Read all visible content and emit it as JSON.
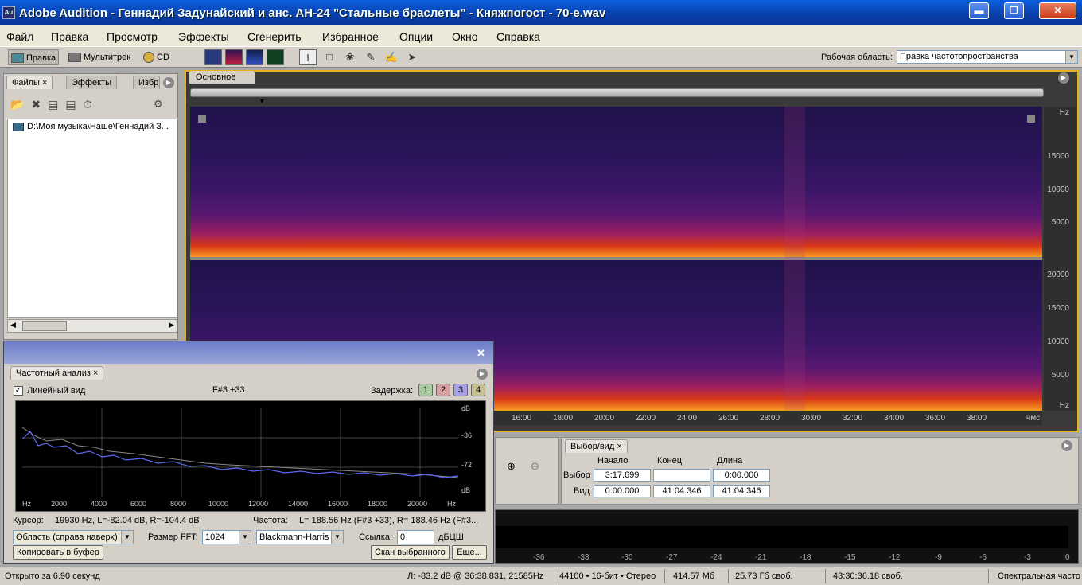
{
  "window": {
    "title": "Adobe Audition - Геннадий Задунайский и анс. АН-24 \"Стальные браслеты\" - Княжпогост - 70-е.wav",
    "icon_text": "Au"
  },
  "menu": [
    "Файл",
    "Правка",
    "Просмотр",
    "Эффекты",
    "Сгенерить",
    "Избранное",
    "Опции",
    "Окно",
    "Справка"
  ],
  "toolbar": {
    "edit": "Правка",
    "multitrack": "Мультитрек",
    "cd": "CD",
    "workspace_label": "Рабочая область:",
    "workspace_value": "Правка частотопространства"
  },
  "left_panel": {
    "tabs": [
      "Файлы",
      "Эффекты",
      "Избр"
    ],
    "file_item": "D:\\Моя музыка\\Наше\\Геннадий З..."
  },
  "main_panel": {
    "tab": "Основное"
  },
  "freq_axis_top": [
    "Hz",
    "15000",
    "10000",
    "5000"
  ],
  "freq_axis_bottom": [
    "20000",
    "15000",
    "10000",
    "5000",
    "Hz"
  ],
  "time_axis": [
    "16:00",
    "18:00",
    "20:00",
    "22:00",
    "24:00",
    "26:00",
    "28:00",
    "30:00",
    "32:00",
    "34:00",
    "36:00",
    "38:00",
    "чмс"
  ],
  "freq_analysis": {
    "tab": "Частотный анализ",
    "linear_view": "Линейный вид",
    "note": "F#3 +33",
    "delay_label": "Задержка:",
    "delays": [
      "1",
      "2",
      "3",
      "4"
    ],
    "db_labels": [
      "dB",
      "-36",
      "-72",
      "dB"
    ],
    "x_labels": [
      "Hz",
      "2000",
      "4000",
      "6000",
      "8000",
      "10000",
      "12000",
      "14000",
      "16000",
      "18000",
      "20000",
      "Hz"
    ],
    "cursor_label": "Курсор:",
    "cursor_value": "19930 Hz, L=-82.04 dB, R=-104.4 dB",
    "freq_label": "Частота:",
    "freq_value": "L= 188.56 Hz (F#3 +33), R= 188.46 Hz (F#3...",
    "area": "Область (справа наверх)",
    "fft_label": "Размер FFT:",
    "fft_value": "1024",
    "window_fn": "Blackmann-Harris",
    "ref_label": "Ссылка:",
    "ref_value": "0",
    "ref_unit": "дБЦШ",
    "copy": "Копировать в буфер",
    "scan": "Скан выбранного",
    "more": "Еще..."
  },
  "selection": {
    "tab": "Выбор/вид",
    "h_start": "Начало",
    "h_end": "Конец",
    "h_len": "Длина",
    "sel_label": "Выбор",
    "sel_start": "3:17.699",
    "sel_end": "",
    "sel_len": "0:00.000",
    "view_label": "Вид",
    "view_start": "0:00.000",
    "view_end": "41:04.346",
    "view_len": "41:04.346"
  },
  "meter_labels": [
    "-36",
    "-33",
    "-30",
    "-27",
    "-24",
    "-21",
    "-18",
    "-15",
    "-12",
    "-9",
    "-6",
    "-3",
    "0"
  ],
  "status": {
    "opened": "Открыто за 6.90 секунд",
    "level": "Л: -83.2 dB @ 36:38.831, 21585Hz",
    "format": "44100 • 16-бит • Стерео",
    "size": "414.57 Мб",
    "free": "25.73 Гб своб.",
    "time_free": "43:30:36.18 своб.",
    "view": "Спектральная часто"
  }
}
